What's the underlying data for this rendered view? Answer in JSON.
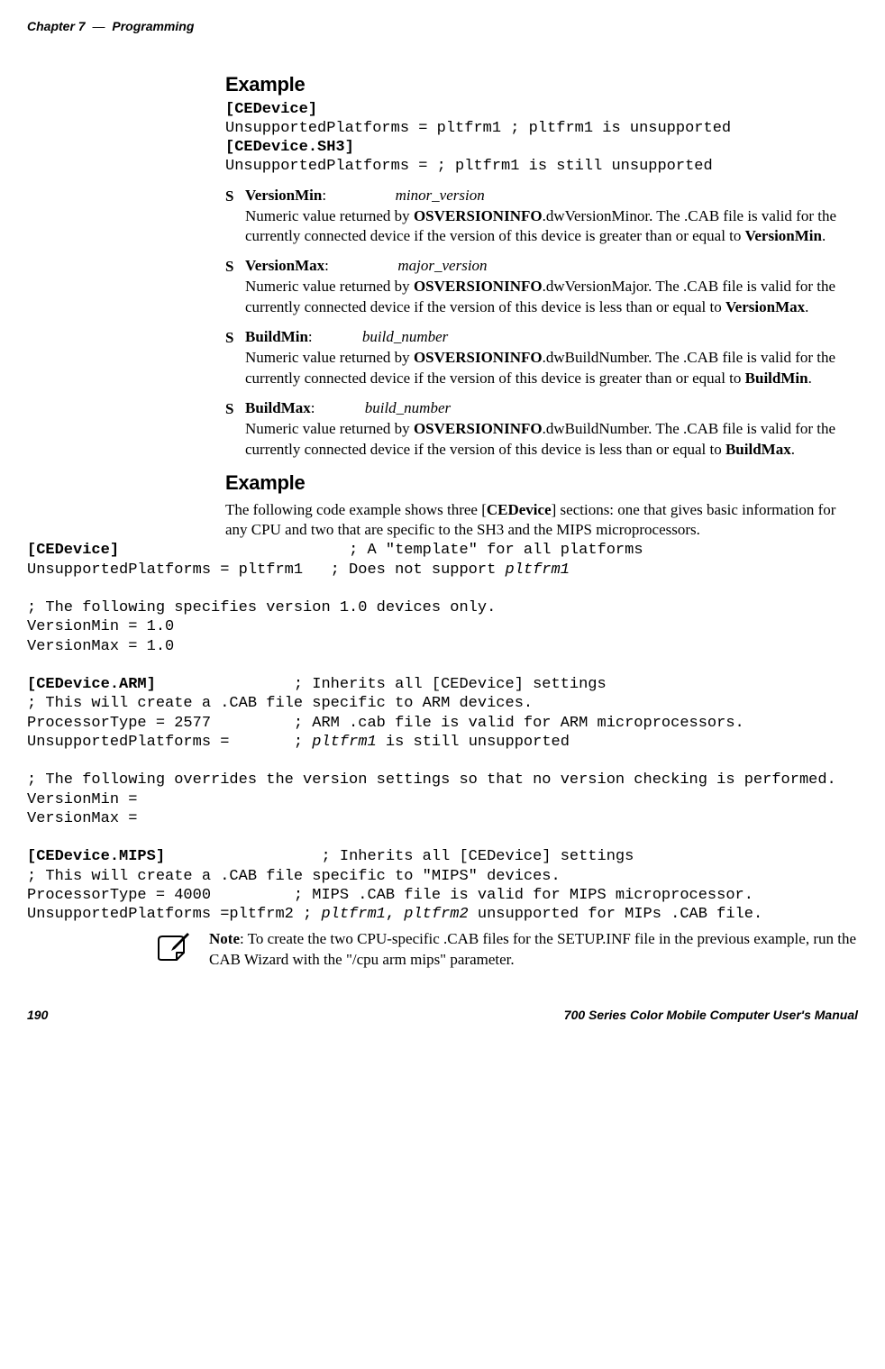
{
  "header": {
    "chapter": "Chapter 7",
    "dash": "—",
    "title": "Programming"
  },
  "example1": {
    "heading": "Example",
    "line1a": "[CEDevice]",
    "line1b": "UnsupportedPlatforms = pltfrm1 ; pltfrm1 is unsupported",
    "line1c": "[CEDevice.SH3]",
    "line1d": "UnsupportedPlatforms = ; pltfrm1 is still unsupported"
  },
  "bullets": [
    {
      "term": "VersionMin",
      "colon": ":",
      "param": "minor_version",
      "desc_pre": "Numeric value returned by ",
      "desc_b1": "OSVERSIONINFO",
      "desc_mid": ".dwVersionMinor. The .CAB file is valid for the currently connected device if the version of this device is greater than or equal to ",
      "desc_b2": "VersionMin",
      "desc_post": "."
    },
    {
      "term": "VersionMax",
      "colon": ":",
      "param": "major_version",
      "desc_pre": "Numeric value returned by ",
      "desc_b1": "OSVERSIONINFO",
      "desc_mid": ".dwVersionMajor. The .CAB file is valid for the currently connected device if the version of this device is less than or equal to ",
      "desc_b2": "VersionMax",
      "desc_post": "."
    },
    {
      "term": "BuildMin",
      "colon": ":",
      "param": "build_number",
      "desc_pre": "Numeric value returned by ",
      "desc_b1": "OSVERSIONINFO",
      "desc_mid": ".dwBuildNumber. The .CAB file is valid for the currently connected device if the version of this device is greater than or equal to ",
      "desc_b2": "BuildMin",
      "desc_post": "."
    },
    {
      "term": "BuildMax",
      "colon": ":",
      "param": "build_number",
      "desc_pre": "Numeric value returned by ",
      "desc_b1": "OSVERSIONINFO",
      "desc_mid": ".dwBuildNumber. The .CAB file is valid for the currently connected device if the version of this device is less than or equal to ",
      "desc_b2": "BuildMax",
      "desc_post": "."
    }
  ],
  "example2": {
    "heading": "Example",
    "intro_pre": "The following code example shows three [",
    "intro_b": "CEDevice",
    "intro_post": "] sections: one that gives basic information for any CPU and two that are specific to the SH3 and the MIPS microprocessors."
  },
  "codeblock": {
    "l01b": "[CEDevice]",
    "l01": "                         ; A \"template\" for all platforms",
    "l02a": "UnsupportedPlatforms = pltfrm1   ; Does not support ",
    "l02i": "pltfrm1",
    "l03": " ",
    "l04": "; The following specifies version 1.0 devices only.",
    "l05": "VersionMin = 1.0",
    "l06": "VersionMax = 1.0",
    "l07": " ",
    "l08b": "[CEDevice.ARM]",
    "l08": "               ; Inherits all [CEDevice] settings",
    "l09": "; This will create a .CAB file specific to ARM devices.",
    "l10": "ProcessorType = 2577         ; ARM .cab file is valid for ARM microprocessors.",
    "l11a": "UnsupportedPlatforms =       ; ",
    "l11i": "pltfrm1",
    "l11b": " is still unsupported",
    "l12": " ",
    "l13": "; The following overrides the version settings so that no version checking is performed.",
    "l14": "VersionMin =",
    "l15": "VersionMax =",
    "l16": " ",
    "l17b": "[CEDevice.MIPS]",
    "l17": "                 ; Inherits all [CEDevice] settings",
    "l18": "; This will create a .CAB file specific to \"MIPS\" devices.",
    "l19": "ProcessorType = 4000         ; MIPS .CAB file is valid for MIPS microprocessor.",
    "l20a": "UnsupportedPlatforms =pltfrm2 ; ",
    "l20i1": "pltfrm1",
    "l20m": ", ",
    "l20i2": "pltfrm2",
    "l20b": " unsupported for MIPs .CAB file."
  },
  "note": {
    "label": "Note",
    "text": ": To create the two CPU-specific .CAB files for the SETUP.INF file in the previous example, run the CAB Wizard with the \"/cpu arm mips\" parameter."
  },
  "footer": {
    "page": "190",
    "title": "700 Series Color Mobile Computer User's Manual"
  }
}
